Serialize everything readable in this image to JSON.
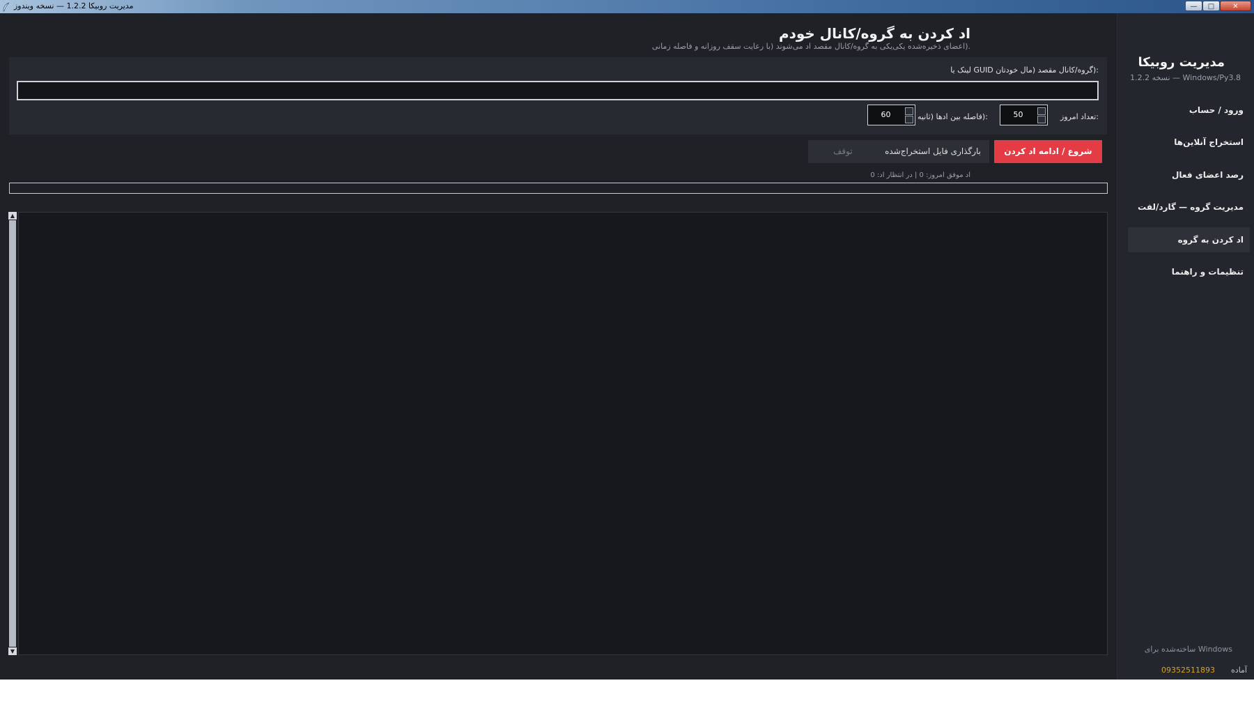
{
  "window": {
    "title": "مدیریت روبیکا 1.2.2 — نسخه ویندوز",
    "minimize_symbol": "—",
    "maximize_symbol": "□",
    "close_symbol": "✕"
  },
  "header": {
    "title": "اد کردن به گروه/کانال خودم",
    "subtitle": ".(اعضای ذخیره‌شده یکی‌یکی به گروه/کانال مقصد اد می‌شوند (با رعایت سقف روزانه و فاصله زمانی"
  },
  "form": {
    "link_label": ":(گروه/کانال مقصد (مال خودتان GUID لینک یا",
    "link_value": "",
    "today_label": ":تعداد امروز",
    "today_value": "50",
    "interval_label": ":(فاصله بین ادها (ثانیه",
    "interval_value": "60"
  },
  "buttons": {
    "start": "شروع / ادامه اد کردن",
    "load": "بارگذاری فایل استخراج‌شده",
    "stop": "توقف"
  },
  "status": {
    "line": "اد موفق امروز: 0 | در انتظار اد: 0",
    "progress": 0
  },
  "log": {
    "content": "",
    "scroll_up": "▲",
    "scroll_down": "▼"
  },
  "sidebar": {
    "app_name": "مدیریت روبیکا",
    "version": "Windows/Py3.8 — نسخه 1.2.2",
    "items": [
      {
        "label": "ورود / حساب"
      },
      {
        "label": "استخراج آنلاین‌ها"
      },
      {
        "label": "رصد اعضای فعال"
      },
      {
        "label": "مدیریت گروه — گارد/لفت"
      },
      {
        "label": "اد کردن به گروه"
      },
      {
        "label": "تنظیمات و راهنما"
      }
    ],
    "active_index": 4,
    "built_for": "Windows ساخته‌شده برای"
  },
  "footer": {
    "phone": "09352511893",
    "status": "آماده"
  },
  "colors": {
    "accent": "#e43c44",
    "background": "#1f2127",
    "sidebar": "#23262d",
    "phone": "#d8a22c"
  }
}
